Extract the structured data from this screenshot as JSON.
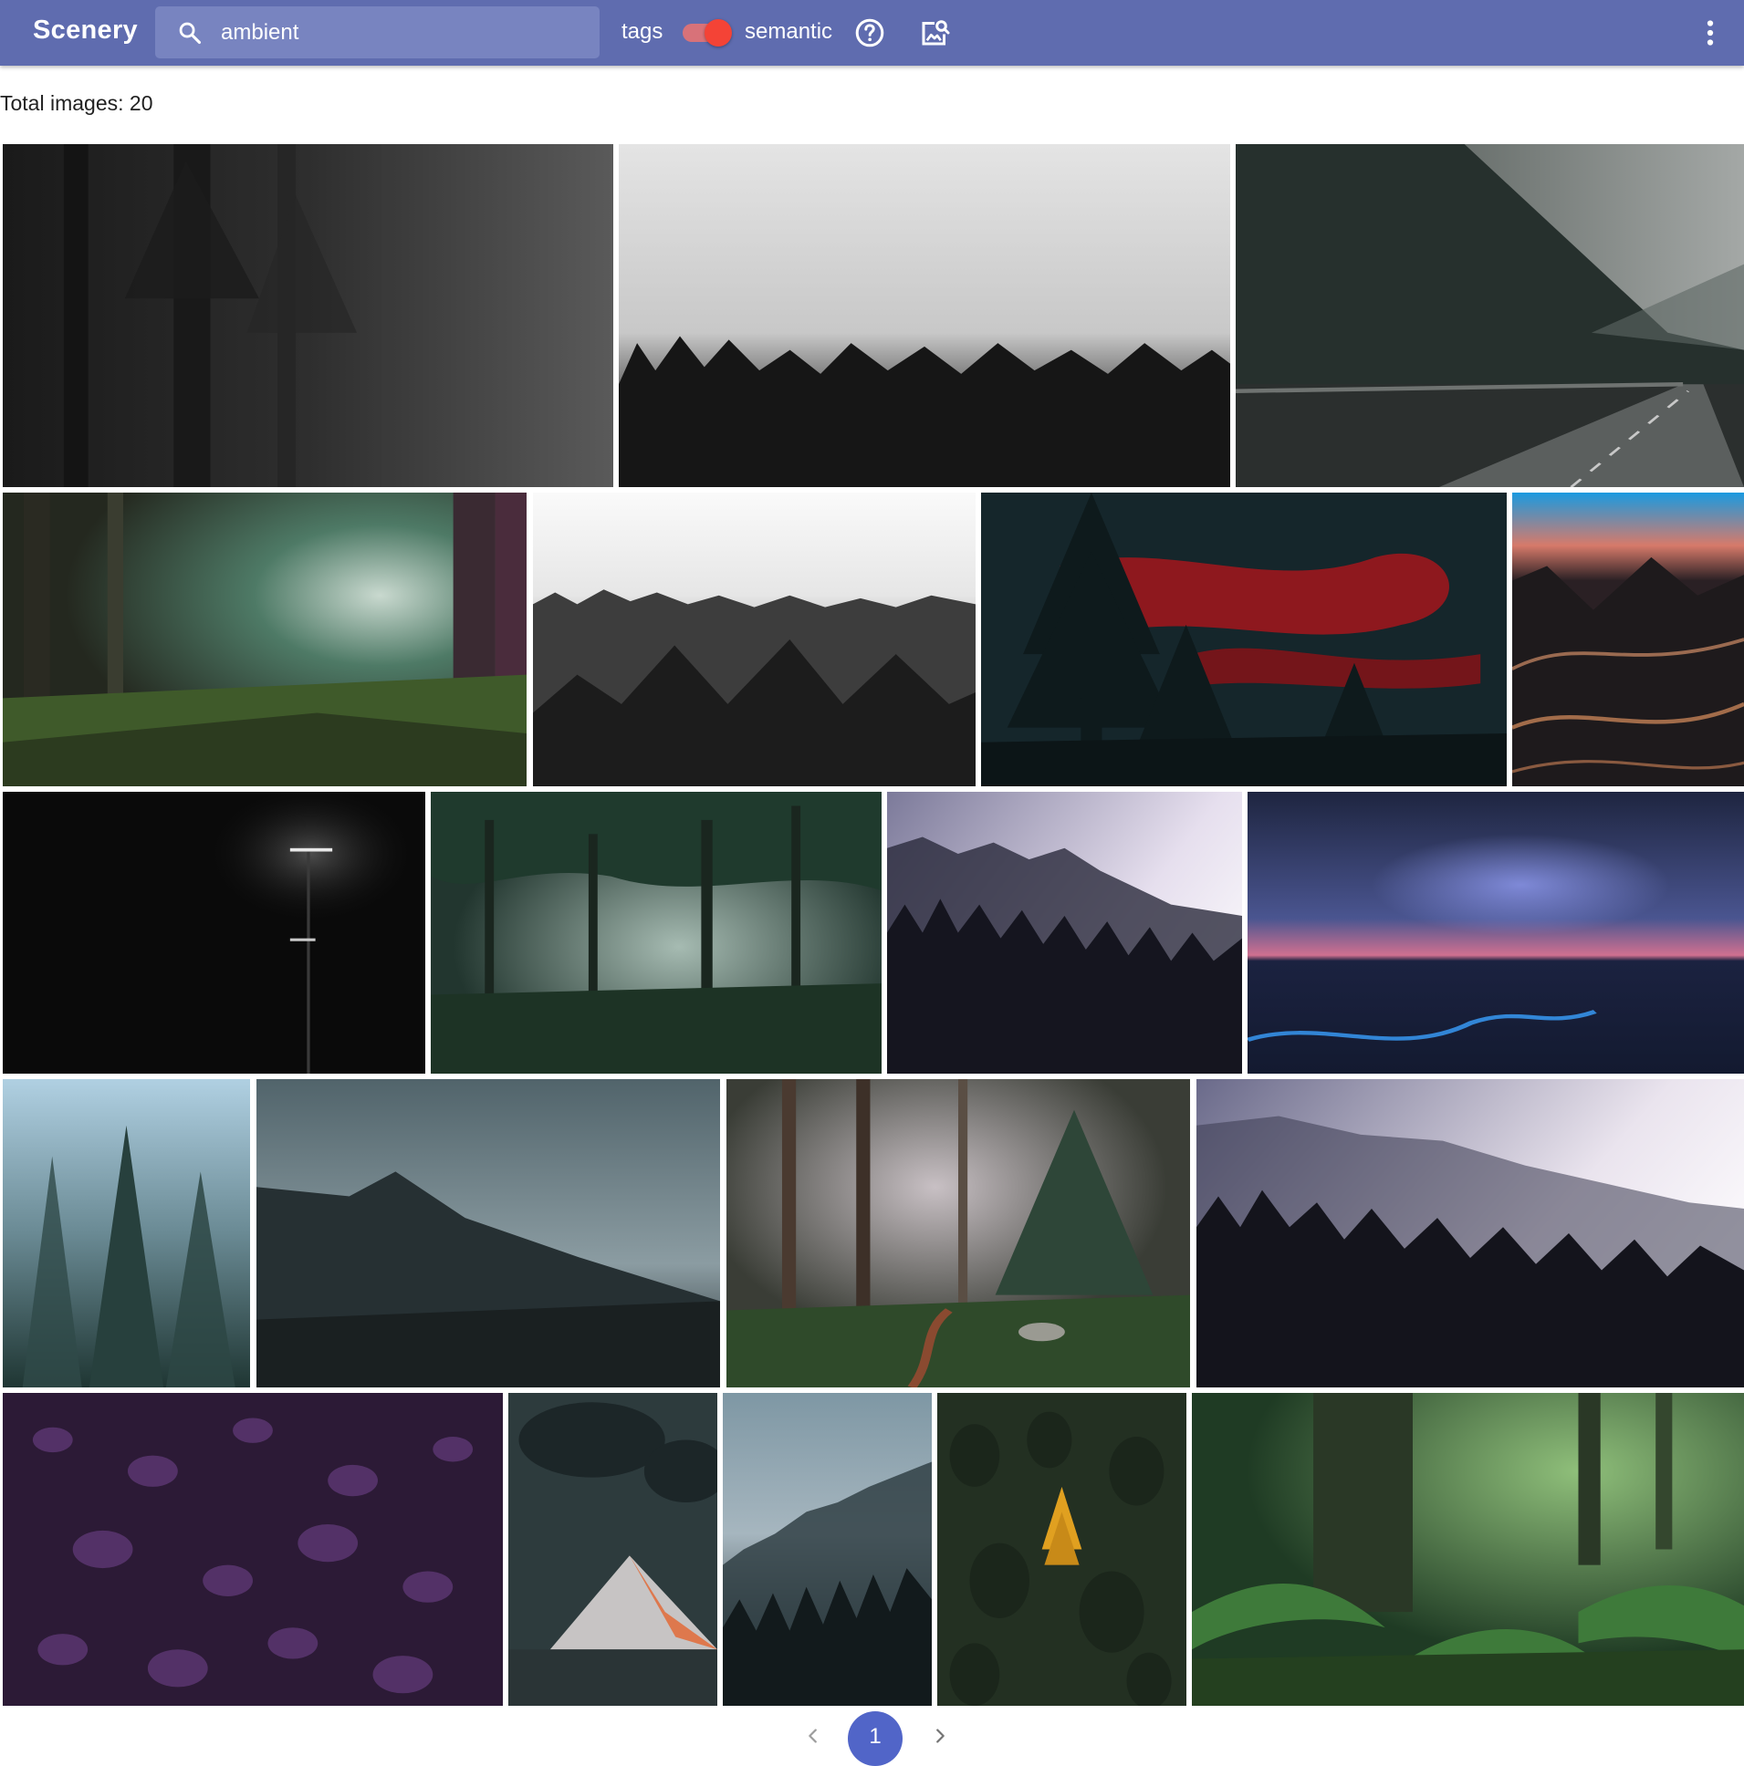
{
  "app": {
    "title": "Scenery"
  },
  "header": {
    "search": {
      "value": "ambient",
      "icon": "search-icon"
    },
    "mode": {
      "left_label": "tags",
      "right_label": "semantic",
      "selected": "semantic"
    },
    "icons": [
      "help-icon",
      "image-search-icon",
      "more-vert-icon"
    ],
    "colors": {
      "appbar": "#5f6caf",
      "toggle": "#f44336"
    }
  },
  "results": {
    "total_label": "Total images: 20"
  },
  "images": [
    {
      "name": "foggy dark forest",
      "icon": "image-thumbnail"
    },
    {
      "name": "misty treeline",
      "icon": "image-thumbnail"
    },
    {
      "name": "mountain road in fog",
      "icon": "image-thumbnail"
    },
    {
      "name": "sunlit green forest",
      "icon": "image-thumbnail"
    },
    {
      "name": "pine trees under white sky",
      "icon": "image-thumbnail"
    },
    {
      "name": "red sky with pines",
      "icon": "image-thumbnail"
    },
    {
      "name": "dark dunes at dusk",
      "icon": "image-thumbnail"
    },
    {
      "name": "street lamps at night",
      "icon": "image-thumbnail"
    },
    {
      "name": "forest clearing in fog",
      "icon": "image-thumbnail"
    },
    {
      "name": "purple mist over forest",
      "icon": "image-thumbnail"
    },
    {
      "name": "ocean horizon glow",
      "icon": "image-thumbnail"
    },
    {
      "name": "blue foggy spruces",
      "icon": "image-thumbnail"
    },
    {
      "name": "misty mountain slope",
      "icon": "image-thumbnail"
    },
    {
      "name": "forest path",
      "icon": "image-thumbnail"
    },
    {
      "name": "pale mist over pines",
      "icon": "image-thumbnail"
    },
    {
      "name": "purple heather",
      "icon": "image-thumbnail"
    },
    {
      "name": "glowing mountain peak",
      "icon": "image-thumbnail"
    },
    {
      "name": "foggy hillside forest",
      "icon": "image-thumbnail"
    },
    {
      "name": "yellow tree in green forest",
      "icon": "image-thumbnail"
    },
    {
      "name": "fern forest",
      "icon": "image-thumbnail"
    }
  ],
  "pagination": {
    "current_page": "1",
    "prev_icon": "chevron-left-icon",
    "next_icon": "chevron-right-icon"
  }
}
